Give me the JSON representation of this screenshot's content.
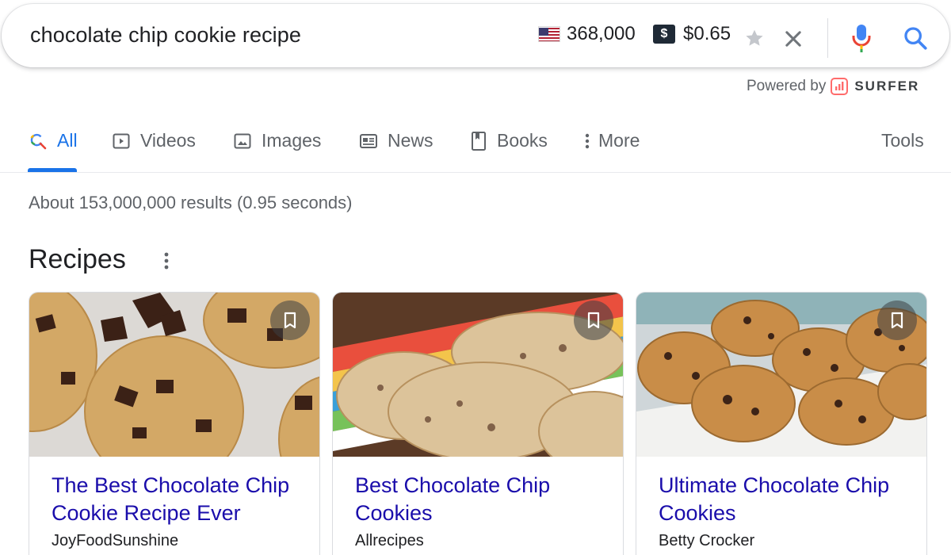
{
  "search": {
    "query": "chocolate chip cookie recipe",
    "volume": "368,000",
    "cpc": "$0.65",
    "cpc_symbol": "$",
    "icons": [
      "us-flag-icon",
      "dollar-icon",
      "star-icon",
      "close-icon",
      "mic-icon",
      "search-icon"
    ]
  },
  "powered_by": {
    "label": "Powered by",
    "brand": "SURFER",
    "accent": "#ff6b6b"
  },
  "tabs": {
    "items": [
      {
        "label": "All",
        "icon": "search-icon",
        "active": true
      },
      {
        "label": "Videos",
        "icon": "video-icon"
      },
      {
        "label": "Images",
        "icon": "image-icon"
      },
      {
        "label": "News",
        "icon": "news-icon"
      },
      {
        "label": "Books",
        "icon": "book-icon"
      },
      {
        "label": "More",
        "icon": "more-vert-icon"
      }
    ],
    "tools": "Tools",
    "active_color": "#1a73e8"
  },
  "results_stats": "About 153,000,000 results (0.95 seconds)",
  "recipes": {
    "title": "Recipes",
    "cards": [
      {
        "title": "The Best Chocolate Chip Cookie Recipe Ever",
        "source": "JoyFoodSunshine"
      },
      {
        "title": "Best Chocolate Chip Cookies",
        "source": "Allrecipes"
      },
      {
        "title": "Ultimate Chocolate Chip Cookies",
        "source": "Betty Crocker"
      }
    ]
  },
  "colors": {
    "link": "#1a0dab",
    "muted": "#5f6368",
    "text": "#202124"
  }
}
